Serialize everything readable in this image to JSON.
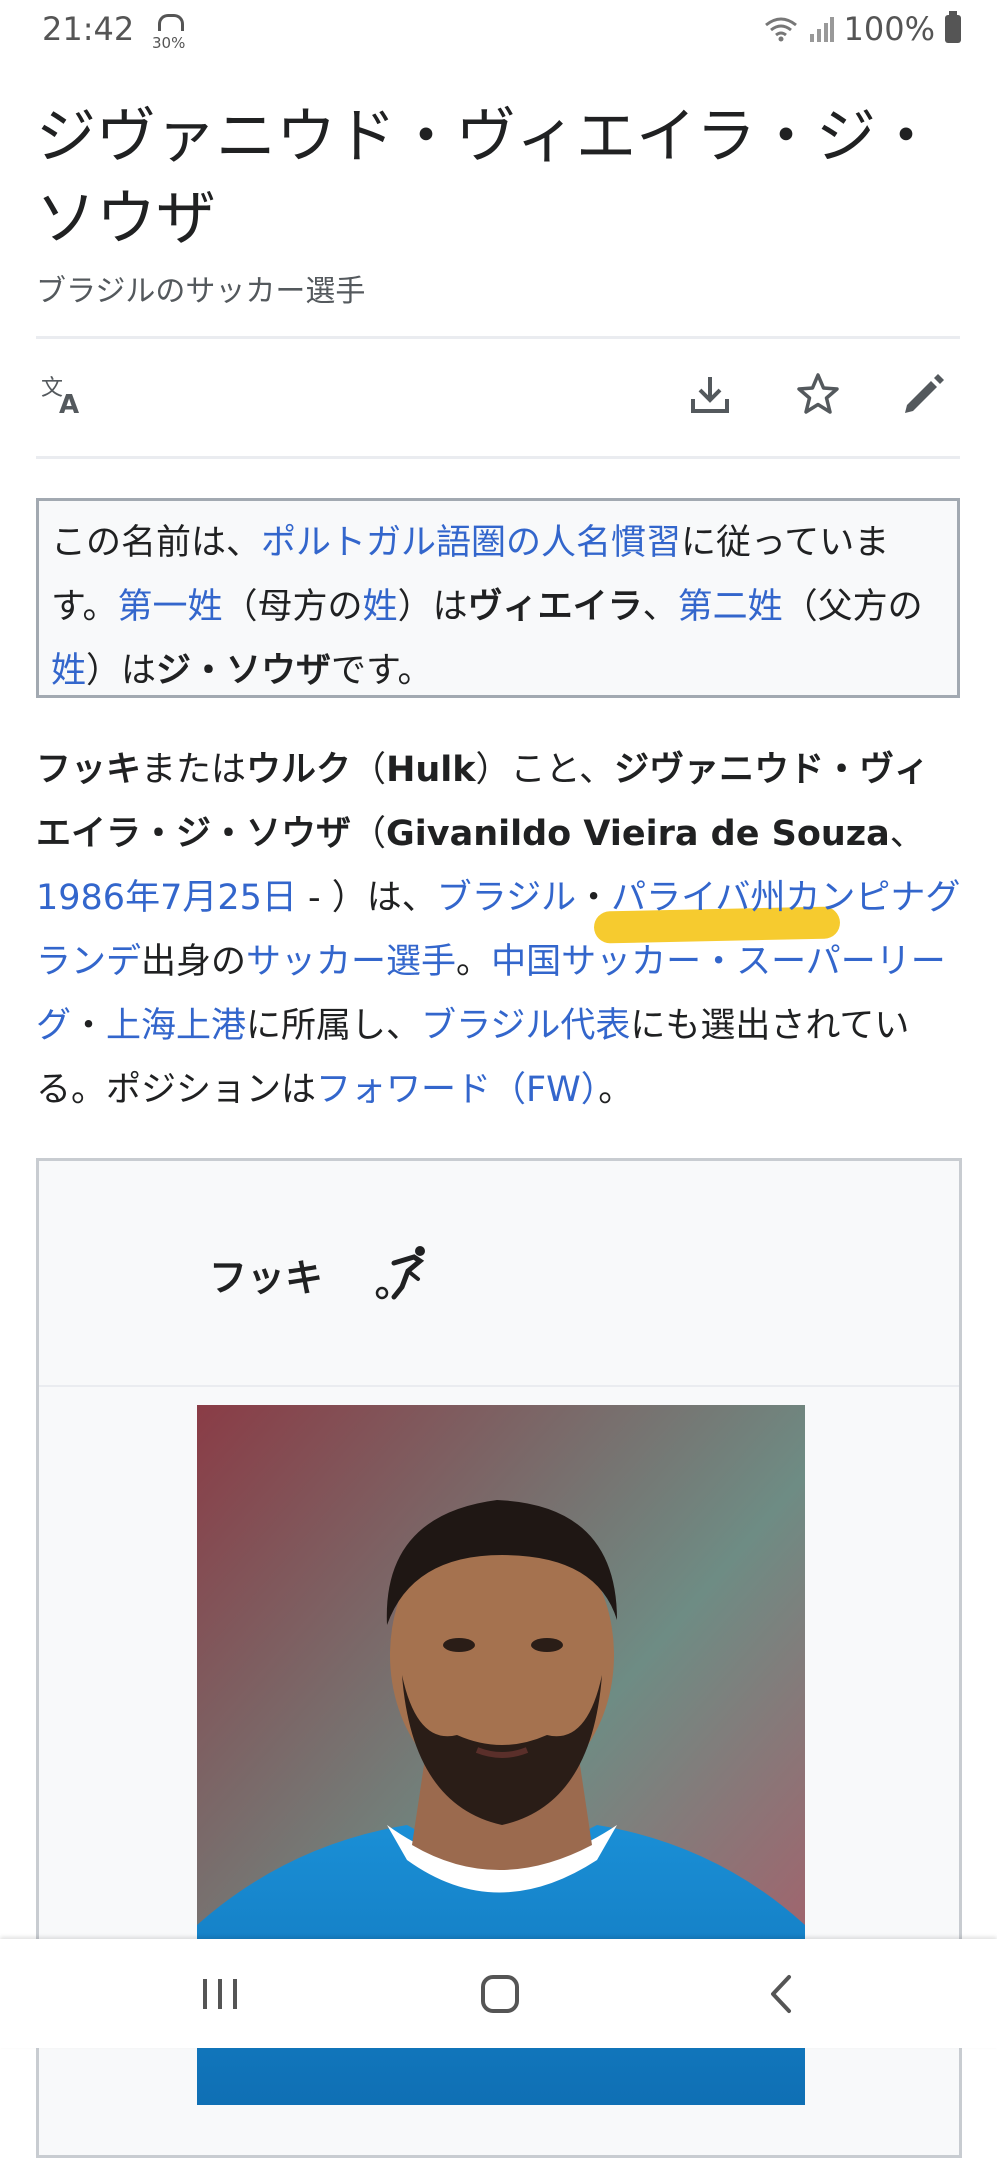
{
  "status_bar": {
    "time": "21:42",
    "weather_percent": "30%",
    "battery": "100%"
  },
  "article": {
    "title": "ジヴァニウド・ヴィエイラ・ジ・ソウザ",
    "subtitle": "ブラジルのサッカー選手"
  },
  "toolbar": {
    "icons": [
      "translate-icon",
      "download-icon",
      "star-icon",
      "edit-icon"
    ]
  },
  "hatnote": {
    "t1": "この名前は、",
    "link1": "ポルトガル語圏の人名慣習",
    "t2": "に従っています。",
    "link2": "第一姓",
    "t3": "（母方の",
    "link3": "姓",
    "t4": "）は",
    "b1": "ヴィエイラ",
    "t5": "、",
    "link4": "第二姓",
    "t6": "（父方の",
    "link5": "姓",
    "t7": "）は",
    "b2": "ジ・ソウザ",
    "t8": "です。"
  },
  "lead": {
    "b1": "フッキ",
    "t1": "または",
    "b2": "ウルク",
    "t2": "（",
    "b3": "Hulk",
    "t3": "）こと、",
    "b4": "ジヴァニウド・ヴィエイラ・ジ・ソウザ",
    "t4": "（",
    "b5": "Givanildo Vieira de Souza",
    "t5": "、",
    "link1": "1986年7月25日",
    "t6": " - ）は、",
    "link2": "ブラジル",
    "t7": "・",
    "link3": "パライバ州",
    "link4": "カンピナグランデ",
    "t8": "出身の",
    "link5": "サッカー選手",
    "t9": "。",
    "link6": "中国サッカー・スーパーリーグ",
    "t10": "・",
    "link7": "上海上港",
    "t11": "に所属し、",
    "link8": "ブラジル代表",
    "t12": "にも選出されている。ポジションは",
    "link9": "フォワード（FW）",
    "t13": "。"
  },
  "infobox": {
    "name": "フッキ",
    "sport_icon": "football-player-icon"
  },
  "colors": {
    "link": "#3366cc",
    "text": "#202122",
    "highlight": "#f5c518",
    "border": "#a2a9b1"
  }
}
